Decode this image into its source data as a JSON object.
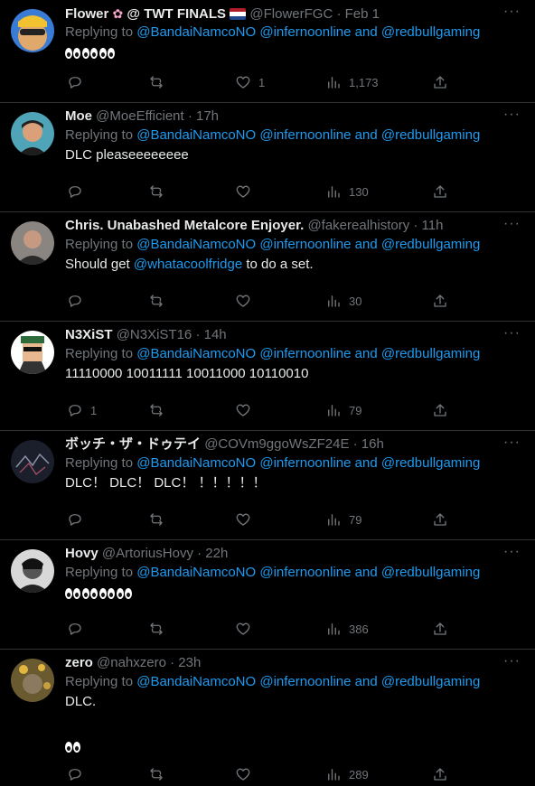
{
  "colors": {
    "background": "#000000",
    "text": "#e7e9ea",
    "muted": "#71767b",
    "link": "#1d9bf0",
    "divider": "#2f3336"
  },
  "icons": {
    "reply": "reply-icon",
    "retweet": "retweet-icon",
    "like": "heart-icon",
    "views": "views-chart-icon",
    "share": "share-icon",
    "more": "more-dots-icon"
  },
  "tweets": [
    {
      "name": "Flower",
      "name_suffix": "@ TWT FINALS",
      "handle_time": "@FlowerFGC · Feb 1",
      "reply_prefix": "Replying to",
      "mentions": [
        "@BandaiNamcoNO",
        "@infernoonline",
        "@redbullgaming"
      ],
      "mention_joiner": "and",
      "text": "",
      "eyes_pairs": 3,
      "reply_count": "",
      "like_count": "1",
      "view_count": "1,173"
    },
    {
      "name": "Moe",
      "name_suffix": "",
      "handle_time": "@MoeEfficient · 17h",
      "reply_prefix": "Replying to",
      "mentions": [
        "@BandaiNamcoNO",
        "@infernoonline",
        "@redbullgaming"
      ],
      "mention_joiner": "and",
      "text": "DLC pleaseeeeeeee",
      "reply_count": "",
      "like_count": "",
      "view_count": "130"
    },
    {
      "name": "Chris. Unabashed Metalcore Enjoyer.",
      "name_suffix": "",
      "handle_time": "@fakerealhistory · 11h",
      "reply_prefix": "Replying to",
      "mentions": [
        "@BandaiNamcoNO",
        "@infernoonline",
        "@redbullgaming"
      ],
      "mention_joiner": "and",
      "text_pre": "Should get ",
      "text_mention": "@whatacoolfridge",
      "text_post": " to do a set.",
      "reply_count": "",
      "like_count": "",
      "view_count": "30"
    },
    {
      "name": "N3XiST",
      "name_suffix": "",
      "handle_time": "@N3XiST16 · 14h",
      "reply_prefix": "Replying to",
      "mentions": [
        "@BandaiNamcoNO",
        "@infernoonline",
        "@redbullgaming"
      ],
      "mention_joiner": "and",
      "text": "11110000 10011111 10011000 10110010",
      "reply_count": "1",
      "like_count": "",
      "view_count": "79"
    },
    {
      "name": "ボッチ・ザ・ドゥテイ",
      "name_suffix": "",
      "handle_time": "@COVm9ggoWsZF24E · 16h",
      "reply_prefix": "Replying to",
      "mentions": [
        "@BandaiNamcoNO",
        "@infernoonline",
        "@redbullgaming"
      ],
      "mention_joiner": "and",
      "text": "DLC！ DLC！ DLC！ ！！！！！",
      "reply_count": "",
      "like_count": "",
      "view_count": "79"
    },
    {
      "name": "Hovy",
      "name_suffix": "",
      "handle_time": "@ArtoriusHovy · 22h",
      "reply_prefix": "Replying to",
      "mentions": [
        "@BandaiNamcoNO",
        "@infernoonline",
        "@redbullgaming"
      ],
      "mention_joiner": "and",
      "text": "",
      "eyes_pairs": 4,
      "reply_count": "",
      "like_count": "",
      "view_count": "386"
    },
    {
      "name": "zero",
      "name_suffix": "",
      "handle_time": "@nahxzero · 23h",
      "reply_prefix": "Replying to",
      "mentions": [
        "@BandaiNamcoNO",
        "@infernoonline",
        "@redbullgaming"
      ],
      "mention_joiner": "and",
      "text": "DLC.",
      "eyes_pairs": 1,
      "reply_count": "",
      "like_count": "",
      "view_count": "289"
    }
  ]
}
